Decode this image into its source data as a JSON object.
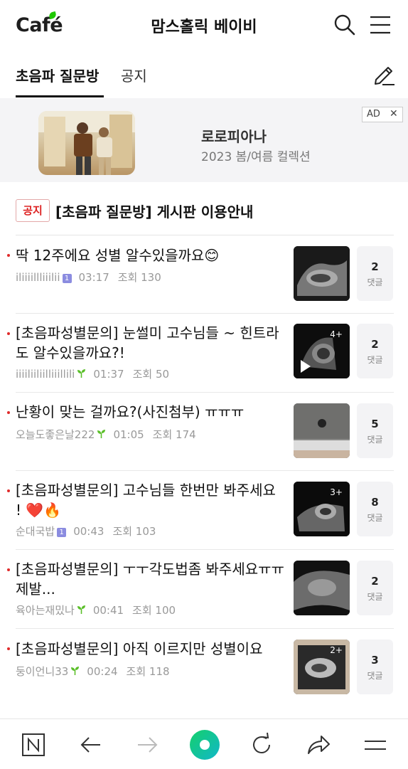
{
  "header": {
    "logo": "Café",
    "cafe_name": "맘스홀릭 베이비"
  },
  "tabs": {
    "active": "초음파 질문방",
    "other": "공지"
  },
  "ad": {
    "title": "로로피아나",
    "subtitle": "2023 봄/여름 컬렉션",
    "badge": "AD"
  },
  "notice": {
    "badge": "공지",
    "title": "[초음파 질문방] 게시판 이용안내"
  },
  "comment_label": "댓글",
  "posts": [
    {
      "title": "딱 12주에요 성별 알수있을까요😊",
      "author": "iliiiillliiilii",
      "time": "03:17",
      "views": "조회 130",
      "comments": "2"
    },
    {
      "title": "[초음파성별문의] 눈썰미 고수님들 ~ 힌트라도 알수있을까요?!",
      "author": "iiiiliiliilliiillili",
      "time": "01:37",
      "views": "조회 50",
      "comments": "2",
      "thumb_count": "4+"
    },
    {
      "title": "난황이 맞는 걸까요?(사진첨부) ㅠㅠㅠ",
      "author": "오늘도좋은날222",
      "time": "01:05",
      "views": "조회 174",
      "comments": "5"
    },
    {
      "title": "[초음파성별문의] 고수님들 한번만 봐주세요 ! ❤️🔥",
      "author": "순대국밥",
      "time": "00:43",
      "views": "조회 103",
      "comments": "8",
      "thumb_count": "3+"
    },
    {
      "title": "[초음파성별문의] ㅜㅜ각도법좀 봐주세요ㅠㅠ제발...",
      "author": "육아는재밌나",
      "time": "00:41",
      "views": "조회 100",
      "comments": "2"
    },
    {
      "title": "[초음파성별문의] 아직 이르지만 성별이요",
      "author": "둥이언니33",
      "time": "00:24",
      "views": "조회 118",
      "comments": "3",
      "thumb_count": "2+"
    }
  ],
  "icons": {
    "header": [
      "search-icon",
      "menu-icon"
    ],
    "tabs": [
      "pencil-icon"
    ],
    "bottom_nav": [
      "naver-home-icon",
      "back-arrow-icon",
      "forward-arrow-icon",
      "green-dot-icon",
      "refresh-icon",
      "share-icon",
      "menu-icon"
    ]
  },
  "colors": {
    "brand_green": "#1ec800",
    "notice_red": "#d22222",
    "level_badge": "#8b8ce0",
    "bullet_red": "#e02a2a"
  }
}
